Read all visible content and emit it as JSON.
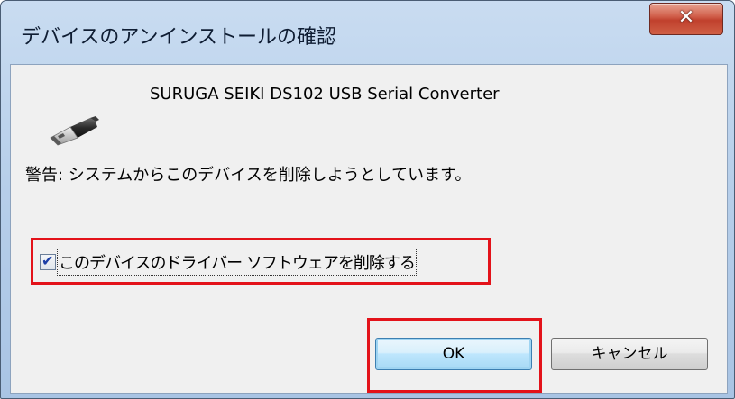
{
  "window": {
    "title": "デバイスのアンインストールの確認",
    "close_glyph": "✕"
  },
  "device": {
    "name": "SURUGA SEIKI DS102 USB Serial Converter",
    "icon": "usb-plug-icon"
  },
  "warning": "警告: システムからこのデバイスを削除しようとしています。",
  "delete_driver_checkbox": {
    "label": "このデバイスのドライバー ソフトウェアを削除する",
    "checked": true
  },
  "buttons": {
    "ok": "OK",
    "cancel": "キャンセル"
  },
  "colors": {
    "highlight": "#e3121a",
    "close_button": "#c0402d",
    "client_background": "#f0f0f0"
  }
}
